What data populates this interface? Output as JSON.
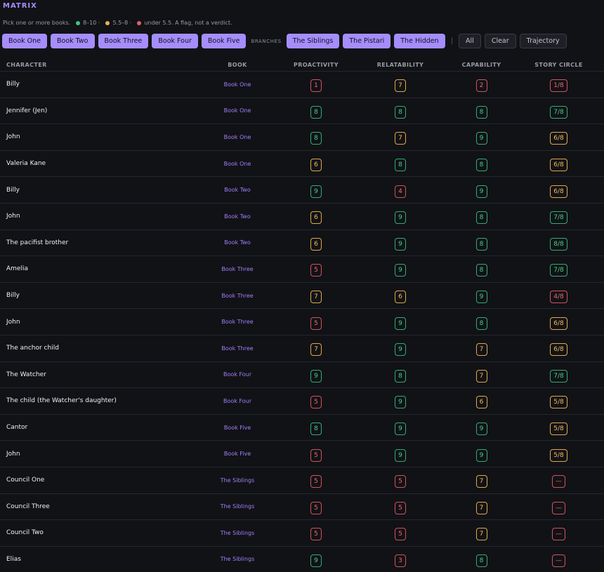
{
  "header": {
    "title": "MATRIX"
  },
  "legend": {
    "intro": "Pick one or more books.",
    "green": "8–10 ·",
    "yellow": "5.5–8 ·",
    "red": "under 5.5. A flag, not a verdict.",
    "colors": {
      "green": "#3fc185",
      "yellow": "#eab057",
      "red": "#e0606a"
    }
  },
  "toolbar": {
    "books": [
      "Book One",
      "Book Two",
      "Book Three",
      "Book Four",
      "Book Five"
    ],
    "branches_label": "BRANCHES",
    "branches": [
      "The Siblings",
      "The Pistari",
      "The Hidden"
    ],
    "separator": "|",
    "all_label": "All",
    "clear_label": "Clear",
    "trajectory_label": "Trajectory"
  },
  "table": {
    "columns": [
      "CHARACTER",
      "BOOK",
      "PROACTIVITY",
      "RELATABILITY",
      "CAPABILITY",
      "STORY CIRCLE"
    ],
    "rows": [
      {
        "name": "Billy",
        "book": "Book One",
        "proactivity": "1",
        "proactivity_level": "r",
        "relatability": "7",
        "relatability_level": "y",
        "capability": "2",
        "capability_level": "r",
        "story_circle": "1/8",
        "story_circle_level": "r"
      },
      {
        "name": "Jennifer (Jen)",
        "book": "Book One",
        "proactivity": "8",
        "proactivity_level": "g",
        "relatability": "8",
        "relatability_level": "g",
        "capability": "8",
        "capability_level": "g",
        "story_circle": "7/8",
        "story_circle_level": "g"
      },
      {
        "name": "John",
        "book": "Book One",
        "proactivity": "8",
        "proactivity_level": "g",
        "relatability": "7",
        "relatability_level": "y",
        "capability": "9",
        "capability_level": "g",
        "story_circle": "6/8",
        "story_circle_level": "y"
      },
      {
        "name": "Valeria Kane",
        "book": "Book One",
        "proactivity": "6",
        "proactivity_level": "y",
        "relatability": "8",
        "relatability_level": "g",
        "capability": "8",
        "capability_level": "g",
        "story_circle": "6/8",
        "story_circle_level": "y"
      },
      {
        "name": "Billy",
        "book": "Book Two",
        "proactivity": "9",
        "proactivity_level": "g",
        "relatability": "4",
        "relatability_level": "r",
        "capability": "9",
        "capability_level": "g",
        "story_circle": "6/8",
        "story_circle_level": "y"
      },
      {
        "name": "John",
        "book": "Book Two",
        "proactivity": "6",
        "proactivity_level": "y",
        "relatability": "9",
        "relatability_level": "g",
        "capability": "8",
        "capability_level": "g",
        "story_circle": "7/8",
        "story_circle_level": "g"
      },
      {
        "name": "The pacifist brother",
        "book": "Book Two",
        "proactivity": "6",
        "proactivity_level": "y",
        "relatability": "9",
        "relatability_level": "g",
        "capability": "8",
        "capability_level": "g",
        "story_circle": "8/8",
        "story_circle_level": "g"
      },
      {
        "name": "Amelia",
        "book": "Book Three",
        "proactivity": "5",
        "proactivity_level": "r",
        "relatability": "9",
        "relatability_level": "g",
        "capability": "8",
        "capability_level": "g",
        "story_circle": "7/8",
        "story_circle_level": "g"
      },
      {
        "name": "Billy",
        "book": "Book Three",
        "proactivity": "7",
        "proactivity_level": "y",
        "relatability": "6",
        "relatability_level": "y",
        "capability": "9",
        "capability_level": "g",
        "story_circle": "4/8",
        "story_circle_level": "r"
      },
      {
        "name": "John",
        "book": "Book Three",
        "proactivity": "5",
        "proactivity_level": "r",
        "relatability": "9",
        "relatability_level": "g",
        "capability": "8",
        "capability_level": "g",
        "story_circle": "6/8",
        "story_circle_level": "y"
      },
      {
        "name": "The anchor child",
        "book": "Book Three",
        "proactivity": "7",
        "proactivity_level": "y",
        "relatability": "9",
        "relatability_level": "g",
        "capability": "7",
        "capability_level": "y",
        "story_circle": "6/8",
        "story_circle_level": "y"
      },
      {
        "name": "The Watcher",
        "book": "Book Four",
        "proactivity": "9",
        "proactivity_level": "g",
        "relatability": "8",
        "relatability_level": "g",
        "capability": "7",
        "capability_level": "y",
        "story_circle": "7/8",
        "story_circle_level": "g"
      },
      {
        "name": "The child (the Watcher's daughter)",
        "book": "Book Four",
        "proactivity": "5",
        "proactivity_level": "r",
        "relatability": "9",
        "relatability_level": "g",
        "capability": "6",
        "capability_level": "y",
        "story_circle": "5/8",
        "story_circle_level": "y"
      },
      {
        "name": "Cantor",
        "book": "Book Five",
        "proactivity": "8",
        "proactivity_level": "g",
        "relatability": "9",
        "relatability_level": "g",
        "capability": "9",
        "capability_level": "g",
        "story_circle": "5/8",
        "story_circle_level": "y"
      },
      {
        "name": "John",
        "book": "Book Five",
        "proactivity": "5",
        "proactivity_level": "r",
        "relatability": "9",
        "relatability_level": "g",
        "capability": "9",
        "capability_level": "g",
        "story_circle": "5/8",
        "story_circle_level": "y"
      },
      {
        "name": "Council One",
        "book": "The Siblings",
        "proactivity": "5",
        "proactivity_level": "r",
        "relatability": "5",
        "relatability_level": "r",
        "capability": "7",
        "capability_level": "y",
        "story_circle": "—",
        "story_circle_level": "r"
      },
      {
        "name": "Council Three",
        "book": "The Siblings",
        "proactivity": "5",
        "proactivity_level": "r",
        "relatability": "5",
        "relatability_level": "r",
        "capability": "7",
        "capability_level": "y",
        "story_circle": "—",
        "story_circle_level": "r"
      },
      {
        "name": "Council Two",
        "book": "The Siblings",
        "proactivity": "5",
        "proactivity_level": "r",
        "relatability": "5",
        "relatability_level": "r",
        "capability": "7",
        "capability_level": "y",
        "story_circle": "—",
        "story_circle_level": "r"
      },
      {
        "name": "Elias",
        "book": "The Siblings",
        "proactivity": "9",
        "proactivity_level": "g",
        "relatability": "3",
        "relatability_level": "r",
        "capability": "8",
        "capability_level": "g",
        "story_circle": "—",
        "story_circle_level": "r"
      }
    ]
  }
}
